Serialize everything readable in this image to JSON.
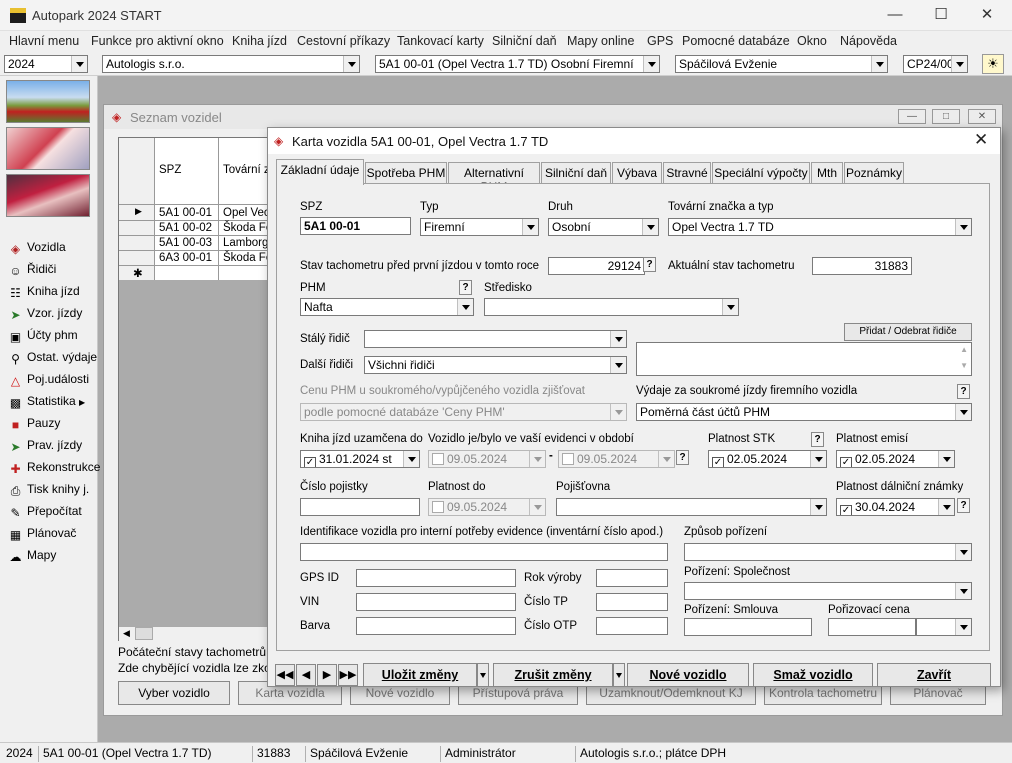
{
  "app": {
    "title": "Autopark 2024 START"
  },
  "menu": [
    "Hlavní menu",
    "Funkce pro aktivní okno",
    "Kniha jízd",
    "Cestovní příkazy",
    "Tankovací karty",
    "Silniční daň",
    "Mapy online",
    "GPS",
    "Pomocné databáze",
    "Okno",
    "Nápověda"
  ],
  "toolbar": {
    "year": "2024",
    "company": "Autologis s.r.o.",
    "vehicle": "5A1 00-01 (Opel Vectra 1.7 TD) Osobní Firemní",
    "driver": "Spáčilová Evženie",
    "cp": "CP24/00"
  },
  "sidebar": {
    "items": [
      {
        "label": "Vozidla",
        "icon": "car-icon"
      },
      {
        "label": "Řidiči",
        "icon": "drivers-icon"
      },
      {
        "label": "Kniha jízd",
        "icon": "book-icon"
      },
      {
        "label": "Vzor. jízdy",
        "icon": "route-icon"
      },
      {
        "label": "Účty phm",
        "icon": "fuel-receipt-icon"
      },
      {
        "label": "Ostat. výdaje",
        "icon": "expenses-icon"
      },
      {
        "label": "Poj.události",
        "icon": "warning-icon"
      },
      {
        "label": "Statistika",
        "icon": "chart-icon"
      },
      {
        "label": "Pauzy",
        "icon": "pause-icon"
      },
      {
        "label": "Prav. jízdy",
        "icon": "regular-trips-icon"
      },
      {
        "label": "Rekonstrukce",
        "icon": "rebuild-icon"
      },
      {
        "label": "Tisk knihy j.",
        "icon": "print-icon"
      },
      {
        "label": "Přepočítat",
        "icon": "recalc-icon"
      },
      {
        "label": "Plánovač",
        "icon": "planner-icon"
      },
      {
        "label": "Mapy",
        "icon": "map-icon"
      }
    ]
  },
  "bgwin": {
    "title": "Seznam vozidel",
    "col_spz": "SPZ",
    "col_make": "Tovární zn",
    "rows": [
      {
        "spz": "5A1 00-01",
        "make": "Opel Vecta"
      },
      {
        "spz": "5A1 00-02",
        "make": "Škoda Fe"
      },
      {
        "spz": "5A1 00-03",
        "make": "Lamborgh"
      },
      {
        "spz": "6A3 00-01",
        "make": "Škoda Fe"
      }
    ],
    "info1": "Počáteční stavy tachometrů jso",
    "info2": "Zde chybějící vozidla lze zkopír",
    "buttons": [
      "Vyber vozidlo",
      "Karta vozidla",
      "Nové vozidlo",
      "Přístupová práva",
      "Uzamknout/Odemknout KJ",
      "Kontrola tachometru",
      "Plánovač"
    ]
  },
  "dialog": {
    "title": "Karta vozidla 5A1 00-01, Opel Vectra 1.7 TD",
    "tabs": [
      "Základní údaje",
      "Spotřeba PHM",
      "Alternativní PHM",
      "Silniční daň",
      "Výbava",
      "Stravné",
      "Speciální výpočty",
      "Mth",
      "Poznámky"
    ],
    "spz_label": "SPZ",
    "spz": "5A1 00-01",
    "typ_label": "Typ",
    "typ": "Firemní",
    "druh_label": "Druh",
    "druh": "Osobní",
    "make_label": "Tovární značka a typ",
    "make": "Opel Vectra 1.7 TD",
    "tacho_start_label": "Stav tachometru před první jízdou v tomto roce",
    "tacho_start": "29124",
    "tacho_now_label": "Aktuální stav tachometru",
    "tacho_now": "31883",
    "phm_label": "PHM",
    "phm": "Nafta",
    "center_label": "Středisko",
    "center": "",
    "driver_label": "Stálý řidič",
    "driver": "",
    "other_label": "Další řidiči",
    "other": "Všichni řidiči",
    "add_driver_btn": "Přidat / Odebrat řidiče",
    "price_label": "Cenu PHM u soukromého/vypůjčeného vozidla zjišťovat",
    "price": "podle pomocné databáze 'Ceny PHM'",
    "private_label": "Výdaje za soukromé jízdy firemního vozidla",
    "private": "Poměrná část účtů PHM",
    "locked_label": "Kniha jízd uzamčena do",
    "locked": "31.01.2024  st",
    "period_label": "Vozidlo je/bylo ve vaší evidenci v období",
    "period_from": "09.05.2024",
    "period_to": "09.05.2024",
    "stk_label": "Platnost STK",
    "stk": "02.05.2024",
    "emis_label": "Platnost emisí",
    "emis": "02.05.2024",
    "policy_label": "Číslo pojistky",
    "policy": "",
    "valid_label": "Platnost do",
    "valid": "09.05.2024",
    "insurer_label": "Pojišťovna",
    "insurer": "",
    "vignette_label": "Platnost dálniční známky",
    "vignette": "30.04.2024",
    "ident_label": "Identifikace vozidla pro interní potřeby evidence (inventární číslo apod.)",
    "ident": "",
    "acq_label": "Způsob pořízení",
    "acq": "",
    "gps_label": "GPS ID",
    "vin_label": "VIN",
    "color_label": "Barva",
    "year_label": "Rok výroby",
    "tp_label": "Číslo TP",
    "otp_label": "Číslo OTP",
    "acq_company_label": "Pořízení: Společnost",
    "acq_contract_label": "Pořízení: Smlouva",
    "acq_price_label": "Pořizovací cena",
    "btn_save": "Uložit změny",
    "btn_cancel": "Zrušit změny",
    "btn_new": "Nové vozidlo",
    "btn_delete": "Smaž vozidlo",
    "btn_close": "Zavřít"
  },
  "status": {
    "year": "2024",
    "vehicle": "5A1 00-01 (Opel Vectra 1.7 TD)",
    "km": "31883",
    "driver": "Spáčilová Evženie",
    "role": "Administrátor",
    "company": "Autologis s.r.o.;  plátce DPH"
  }
}
